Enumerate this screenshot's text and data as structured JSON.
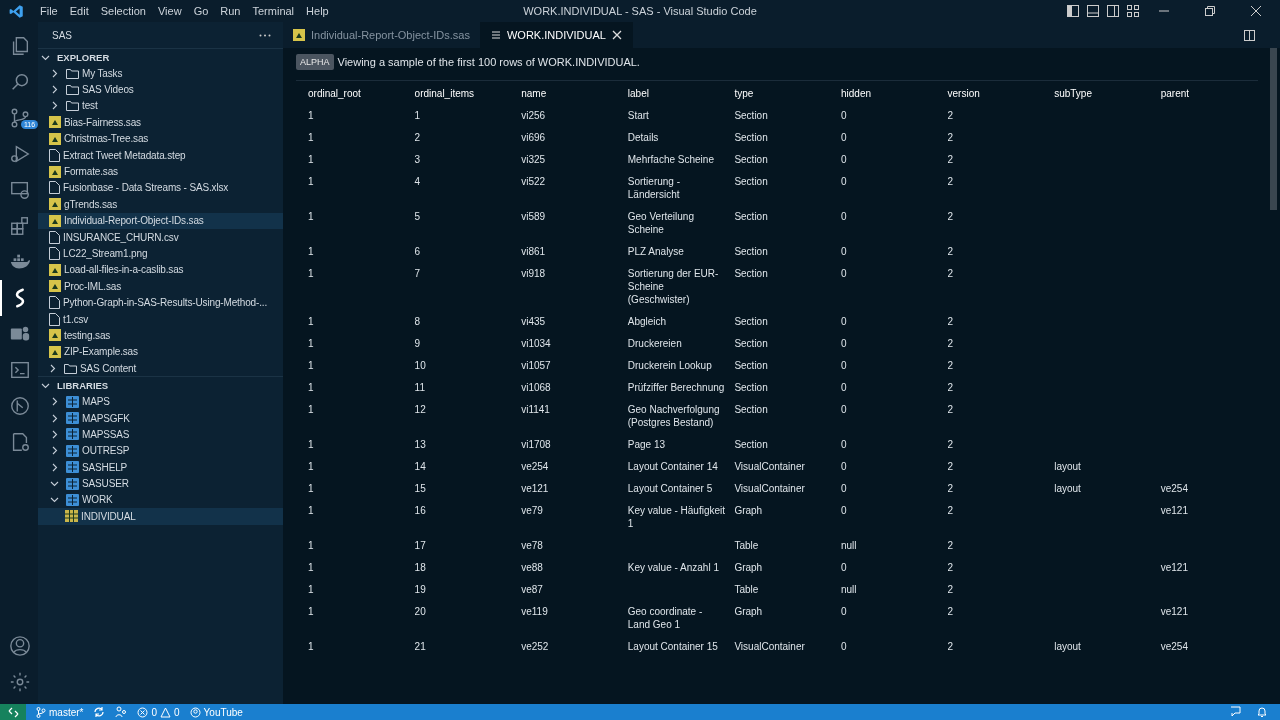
{
  "title_bar": {
    "menu": [
      "File",
      "Edit",
      "Selection",
      "View",
      "Go",
      "Run",
      "Terminal",
      "Help"
    ],
    "title": "WORK.INDIVIDUAL - SAS - Visual Studio Code"
  },
  "activity_bar": {
    "top": [
      {
        "kind": "files",
        "selected": false
      },
      {
        "kind": "search",
        "selected": false
      },
      {
        "kind": "source-control",
        "selected": false,
        "badge": "116"
      },
      {
        "kind": "run",
        "selected": false
      },
      {
        "kind": "remote",
        "selected": false
      },
      {
        "kind": "extensions",
        "selected": false
      },
      {
        "kind": "docker",
        "selected": false
      },
      {
        "kind": "sas",
        "selected": true
      },
      {
        "kind": "teams",
        "selected": false
      },
      {
        "kind": "terminal",
        "selected": false
      },
      {
        "kind": "git-graph",
        "selected": false
      },
      {
        "kind": "report",
        "selected": false
      }
    ],
    "bottom": [
      {
        "kind": "account",
        "selected": false
      },
      {
        "kind": "settings",
        "selected": false
      }
    ]
  },
  "sidebar": {
    "title": "SAS",
    "sections": [
      {
        "kind": "view",
        "title": "EXPLORER",
        "expanded": true,
        "items": [
          {
            "label": "My Tasks",
            "kind": "folder",
            "expanded": false,
            "selected": false
          },
          {
            "label": "SAS Videos",
            "kind": "folder",
            "expanded": false,
            "selected": false
          },
          {
            "label": "test",
            "kind": "folder",
            "expanded": false,
            "selected": false
          },
          {
            "label": "Bias-Fairness.sas",
            "kind": "sas",
            "selected": false
          },
          {
            "label": "Christmas-Tree.sas",
            "kind": "sas",
            "selected": false
          },
          {
            "label": "Extract Tweet Metadata.step",
            "kind": "file",
            "selected": false
          },
          {
            "label": "Formate.sas",
            "kind": "sas",
            "selected": false
          },
          {
            "label": "Fusionbase - Data Streams - SAS.xlsx",
            "kind": "file",
            "selected": false
          },
          {
            "label": "gTrends.sas",
            "kind": "sas",
            "selected": false
          },
          {
            "label": "Individual-Report-Object-IDs.sas",
            "kind": "sas",
            "selected": true
          },
          {
            "label": "INSURANCE_CHURN.csv",
            "kind": "file",
            "selected": false
          },
          {
            "label": "LC22_Stream1.png",
            "kind": "file",
            "selected": false
          },
          {
            "label": "Load-all-files-in-a-caslib.sas",
            "kind": "sas",
            "selected": false
          },
          {
            "label": "Proc-IML.sas",
            "kind": "sas",
            "selected": false
          },
          {
            "label": "Python-Graph-in-SAS-Results-Using-Method-...",
            "kind": "file",
            "selected": false
          },
          {
            "label": "t1.csv",
            "kind": "file",
            "selected": false
          },
          {
            "label": "testing.sas",
            "kind": "sas",
            "selected": false
          },
          {
            "label": "ZIP-Example.sas",
            "kind": "sas",
            "selected": false
          }
        ]
      },
      {
        "kind": "folder-row",
        "title": "SAS Content",
        "expanded": false
      },
      {
        "kind": "view",
        "title": "LIBRARIES",
        "expanded": true,
        "items": [
          {
            "label": "MAPS",
            "kind": "library",
            "expanded": false,
            "selected": false
          },
          {
            "label": "MAPSGFK",
            "kind": "library",
            "expanded": false,
            "selected": false
          },
          {
            "label": "MAPSSAS",
            "kind": "library",
            "expanded": false,
            "selected": false
          },
          {
            "label": "OUTRESP",
            "kind": "library",
            "expanded": false,
            "selected": false
          },
          {
            "label": "SASHELP",
            "kind": "library",
            "expanded": false,
            "selected": false
          },
          {
            "label": "SASUSER",
            "kind": "library",
            "expanded": true,
            "selected": false
          },
          {
            "label": "WORK",
            "kind": "library",
            "expanded": true,
            "selected": false,
            "children": [
              {
                "label": "INDIVIDUAL",
                "kind": "table",
                "selected": true
              }
            ]
          }
        ]
      }
    ]
  },
  "tabs": [
    {
      "label": "Individual-Report-Object-IDs.sas",
      "kind": "sas",
      "selected": false
    },
    {
      "label": "WORK.INDIVIDUAL",
      "kind": "table",
      "selected": true
    }
  ],
  "notice": {
    "badge": "ALPHA",
    "text": "Viewing a sample of the first 100 rows of WORK.INDIVIDUAL."
  },
  "table": {
    "columns": [
      "ordinal_root",
      "ordinal_items",
      "name",
      "label",
      "type",
      "hidden",
      "version",
      "subType",
      "parent"
    ],
    "rows": [
      [
        "1",
        "1",
        "vi256",
        "Start",
        "Section",
        "0",
        "2",
        "",
        ""
      ],
      [
        "1",
        "2",
        "vi696",
        "Details",
        "Section",
        "0",
        "2",
        "",
        ""
      ],
      [
        "1",
        "3",
        "vi325",
        "Mehrfache Scheine",
        "Section",
        "0",
        "2",
        "",
        ""
      ],
      [
        "1",
        "4",
        "vi522",
        "Sortierung - Ländersicht",
        "Section",
        "0",
        "2",
        "",
        ""
      ],
      [
        "1",
        "5",
        "vi589",
        "Geo Verteilung Scheine",
        "Section",
        "0",
        "2",
        "",
        ""
      ],
      [
        "1",
        "6",
        "vi861",
        "PLZ Analyse",
        "Section",
        "0",
        "2",
        "",
        ""
      ],
      [
        "1",
        "7",
        "vi918",
        "Sortierung der EUR-Scheine (Geschwister)",
        "Section",
        "0",
        "2",
        "",
        ""
      ],
      [
        "1",
        "8",
        "vi435",
        "Abgleich",
        "Section",
        "0",
        "2",
        "",
        ""
      ],
      [
        "1",
        "9",
        "vi1034",
        "Druckereien",
        "Section",
        "0",
        "2",
        "",
        ""
      ],
      [
        "1",
        "10",
        "vi1057",
        "Druckerein Lookup",
        "Section",
        "0",
        "2",
        "",
        ""
      ],
      [
        "1",
        "11",
        "vi1068",
        "Prüfziffer Berechnung",
        "Section",
        "0",
        "2",
        "",
        ""
      ],
      [
        "1",
        "12",
        "vi1141",
        "Geo Nachverfolgung (Postgres Bestand)",
        "Section",
        "0",
        "2",
        "",
        ""
      ],
      [
        "1",
        "13",
        "vi1708",
        "Page 13",
        "Section",
        "0",
        "2",
        "",
        ""
      ],
      [
        "1",
        "14",
        "ve254",
        "Layout Container 14",
        "VisualContainer",
        "0",
        "2",
        "layout",
        ""
      ],
      [
        "1",
        "15",
        "ve121",
        "Layout Container 5",
        "VisualContainer",
        "0",
        "2",
        "layout",
        "ve254"
      ],
      [
        "1",
        "16",
        "ve79",
        "Key value - Häufigkeit 1",
        "Graph",
        "0",
        "2",
        "",
        "ve121"
      ],
      [
        "1",
        "17",
        "ve78",
        "",
        "Table",
        "null",
        "2",
        "",
        ""
      ],
      [
        "1",
        "18",
        "ve88",
        "Key value - Anzahl 1",
        "Graph",
        "0",
        "2",
        "",
        "ve121"
      ],
      [
        "1",
        "19",
        "ve87",
        "",
        "Table",
        "null",
        "2",
        "",
        ""
      ],
      [
        "1",
        "20",
        "ve119",
        "Geo coordinate - Land Geo 1",
        "Graph",
        "0",
        "2",
        "",
        "ve121"
      ],
      [
        "1",
        "21",
        "ve252",
        "Layout Container 15",
        "VisualContainer",
        "0",
        "2",
        "layout",
        "ve254"
      ]
    ]
  },
  "status_bar": {
    "branch": "master*",
    "errors": "0",
    "warnings": "0",
    "account": "YouTube"
  }
}
